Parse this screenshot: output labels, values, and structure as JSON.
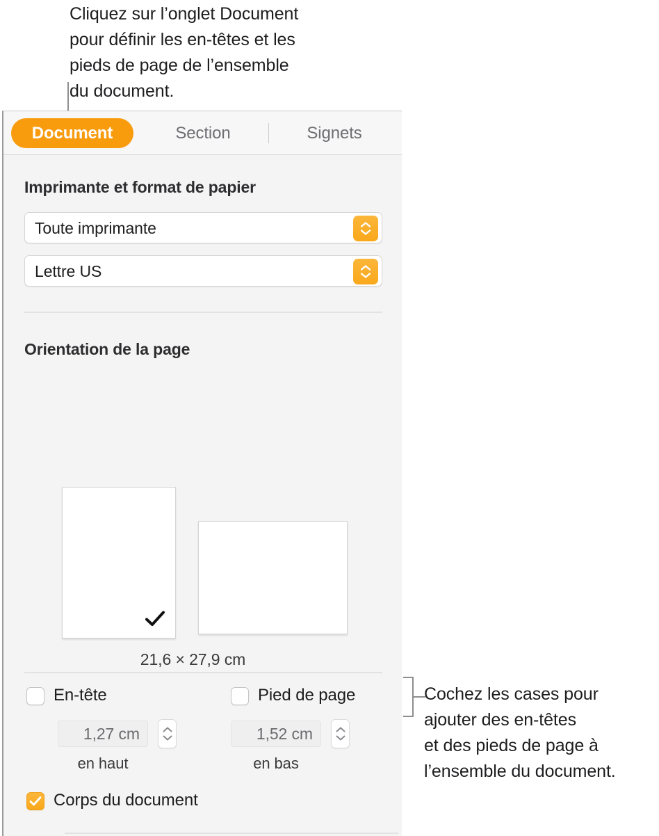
{
  "callouts": {
    "top": "Cliquez sur l’onglet Document\npour définir les en-têtes et les\npieds de page de l’ensemble\ndu document.",
    "right": "Cochez les cases pour\najouter des en-têtes\net des pieds de page à\nl’ensemble du document."
  },
  "panel": {
    "tabs": [
      {
        "id": "document",
        "label": "Document",
        "active": true
      },
      {
        "id": "section",
        "label": "Section",
        "active": false
      },
      {
        "id": "signets",
        "label": "Signets",
        "active": false
      }
    ],
    "printer_section": {
      "title": "Imprimante et format de papier",
      "printer": {
        "value": "Toute imprimante"
      },
      "paper": {
        "value": "Lettre US"
      }
    },
    "orientation_section": {
      "title": "Orientation de la page",
      "portrait_selected": true,
      "landscape_selected": false,
      "paper_dimensions": "21,6 × 27,9 cm"
    },
    "header_footer_section": {
      "header": {
        "label": "En-tête",
        "checked": false,
        "value": "1,27 cm",
        "sublabel": "en haut"
      },
      "footer": {
        "label": "Pied de page",
        "checked": false,
        "value": "1,52 cm",
        "sublabel": "en bas"
      },
      "body": {
        "label": "Corps du document",
        "checked": true
      }
    }
  },
  "colors": {
    "accent_orange": "#F89B0C",
    "panel_background": "#F4F4F4",
    "tabbar_background": "#F7F7F7",
    "divider": "#E2E2E2"
  }
}
